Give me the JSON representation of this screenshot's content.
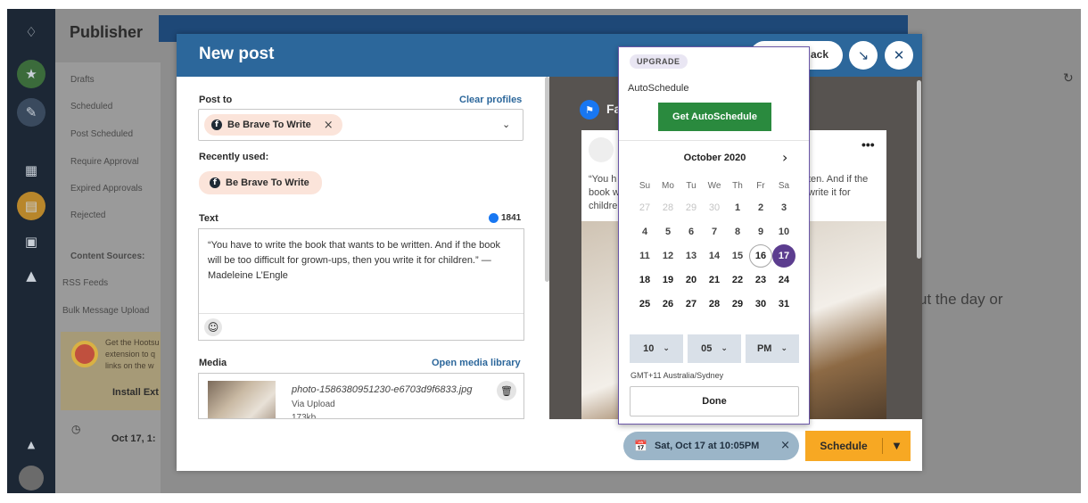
{
  "background": {
    "app_title": "Publisher",
    "sidebar_items": [
      "Drafts",
      "Scheduled",
      "Post Scheduled",
      "Require Approval",
      "Expired Approvals",
      "Rejected"
    ],
    "content_sources_label": "Content Sources:",
    "source_items": [
      "RSS Feeds",
      "Bulk Message Upload"
    ],
    "extension_text": [
      "Get the Hootsu",
      "extension to q",
      "links on the w"
    ],
    "install_label": "Install Ext",
    "date_text": "Oct 17, 1:",
    "right_text": "ut the day or"
  },
  "modal": {
    "title": "New post",
    "back_label": "ack",
    "minimize_icon": "arrow-down-right-icon",
    "close_icon": "close-icon"
  },
  "compose": {
    "post_to_label": "Post to",
    "clear_profiles": "Clear profiles",
    "selected_profile": "Be Brave To Write",
    "recently_used_label": "Recently used:",
    "recent_profile": "Be Brave To Write",
    "text_label": "Text",
    "char_count": "1841",
    "text_value": "“You have to write the book that wants to be written. And if the book will be too difficult for grown-ups, then you write it for children.” — Madeleine L’Engle",
    "media_label": "Media",
    "open_media_library": "Open media library",
    "media_filename": "photo-1586380951230-e6703d9f6833.jpg",
    "media_source": "Via Upload",
    "media_size": "173kb"
  },
  "preview": {
    "network_label": "Fa",
    "text_left": [
      "“You h",
      "book w",
      "childre"
    ],
    "text_right": [
      "ten. And if the",
      "write it for"
    ],
    "menu_dots": "•••"
  },
  "scheduler": {
    "upgrade_badge": "UPGRADE",
    "autoschedule_label": "AutoSchedule",
    "autoschedule_button": "Get AutoSchedule",
    "month_label": "October 2020",
    "weekdays": [
      "Su",
      "Mo",
      "Tu",
      "We",
      "Th",
      "Fr",
      "Sa"
    ],
    "weeks": [
      [
        "27",
        "28",
        "29",
        "30",
        "1",
        "2",
        "3"
      ],
      [
        "4",
        "5",
        "6",
        "7",
        "8",
        "9",
        "10"
      ],
      [
        "11",
        "12",
        "13",
        "14",
        "15",
        "16",
        "17"
      ],
      [
        "18",
        "19",
        "20",
        "21",
        "22",
        "23",
        "24"
      ],
      [
        "25",
        "26",
        "27",
        "28",
        "29",
        "30",
        "31"
      ]
    ],
    "today_day": "16",
    "selected_day": "17",
    "hour": "10",
    "minute": "05",
    "meridiem": "PM",
    "timezone": "GMT+11 Australia/Sydney",
    "done_label": "Done",
    "accent_color": "#5c3d8f"
  },
  "footer": {
    "scheduled_time": "Sat, Oct 17 at 10:05PM",
    "schedule_label": "Schedule",
    "schedule_color": "#f7a823"
  }
}
